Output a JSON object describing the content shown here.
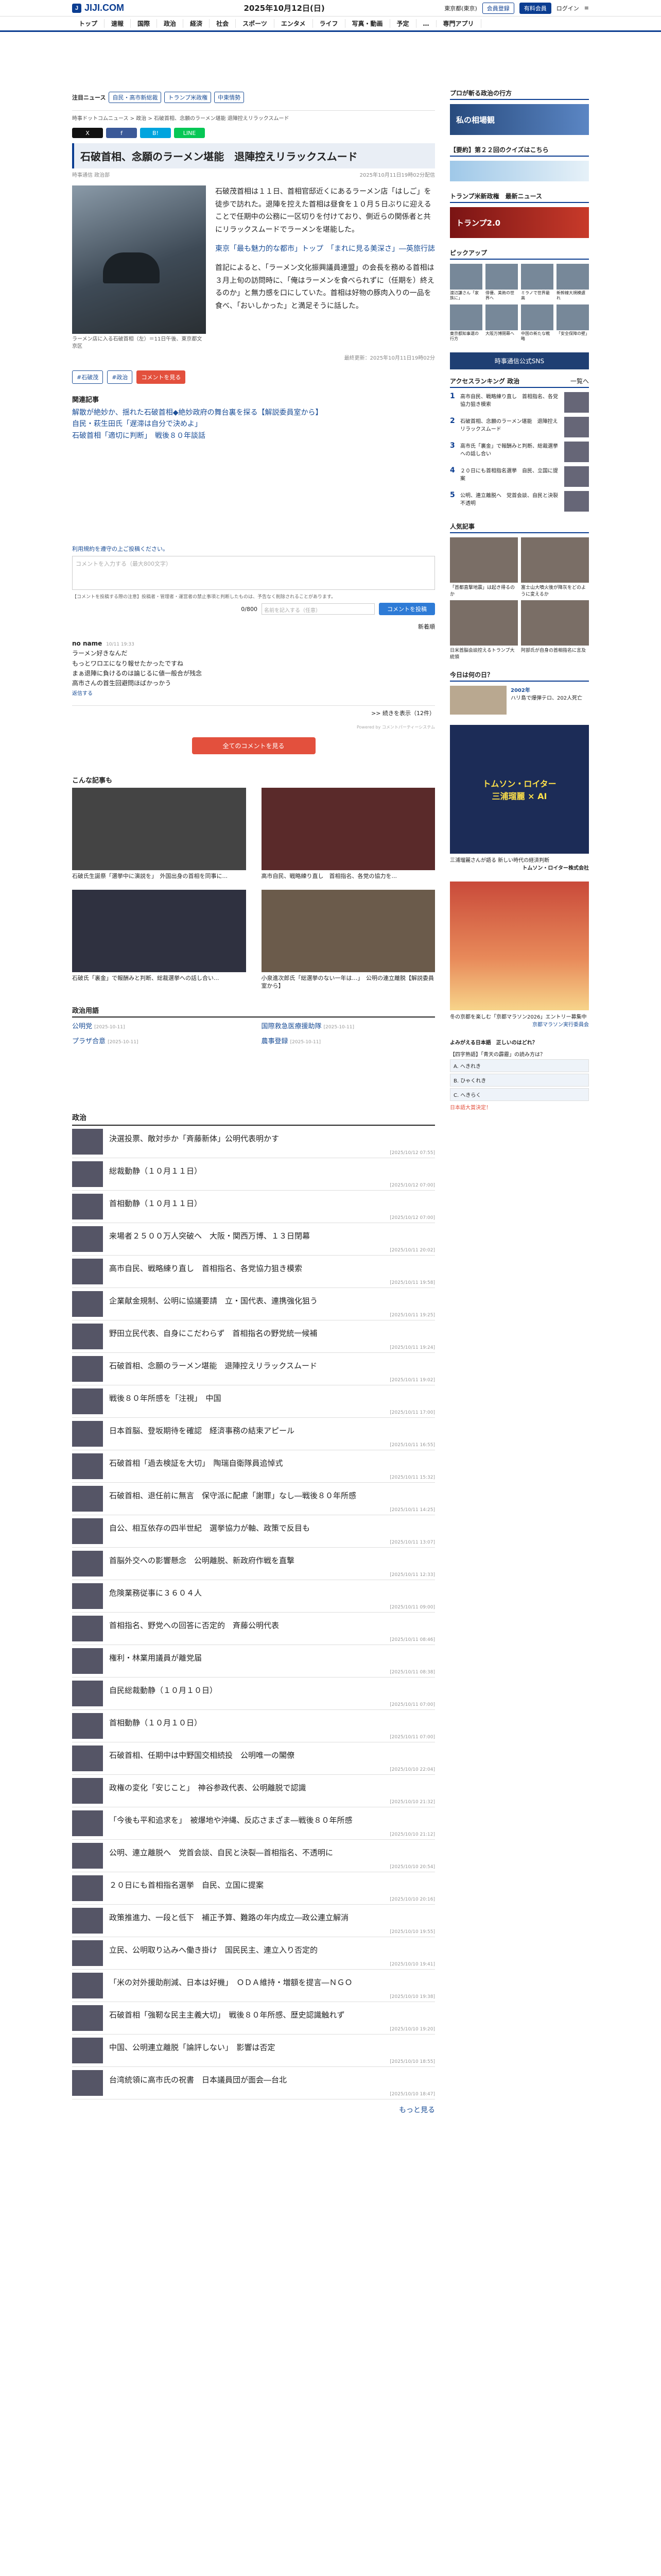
{
  "header": {
    "logo": "JIJI.COM",
    "date": "2025年10月12日(日)",
    "weather": "東京都(東京)",
    "links": [
      "会員登録",
      "有料会員",
      "ログイン",
      "≡"
    ]
  },
  "nav": [
    "トップ",
    "速報",
    "国際",
    "政治",
    "経済",
    "社会",
    "スポーツ",
    "エンタメ",
    "ライフ",
    "写真・動画",
    "予定",
    "…",
    "専門アプリ"
  ],
  "tags": {
    "label": "注目ニュース",
    "items": [
      "自民・高市新総裁",
      "トランプ米政権",
      "中東情勢"
    ]
  },
  "share": [
    "X",
    "f",
    "B!",
    "LINE"
  ],
  "breadcrumb": "時事ドットコムニュース > 政治 > 石破首相、念願のラーメン堪能 退陣控えリラックスムード",
  "article": {
    "title": "石破首相、念願のラーメン堪能　退陣控えリラックスムード",
    "author": "時事通信 政治部",
    "date": "2025年10月11日19時02分配信",
    "caption": "ラーメン店に入る石破首相（左）＝11日午後、東京都文京区",
    "p1": "石破茂首相は１１日、首相官邸近くにあるラーメン店「はしご」を徒歩で訪れた。退陣を控えた首相は昼食を１０月５日ぶりに迎えることで任期中の公務に一区切りを付けており、側近らの関係者と共にリラックスムードでラーメンを堪能した。",
    "link1": "東京「最も魅力的な都市」トップ　「まれに見る美深さ」―英旅行誌",
    "p2": "首記によると、「ラーメン文化振興議員連盟」の会長を務める首相は３月上旬の訪問時に、「俺はラーメンを食べられずに（任期を）終えるのか」と無力感を口にしていた。首相は好物の豚肉入りの一品を食べ、「おいしかった」と満足そうに話した。",
    "stamp": "最終更新：2025年10月11日19時02分",
    "buttons": [
      "#石破茂",
      "#政治",
      "コメントを見る"
    ]
  },
  "related": {
    "heading": "関連記事",
    "items": [
      "解散が絶妙か、揺れた石破首相◆絶妙政府の舞台裏を探る【解説委員室から】",
      "自民・萩生田氏「遅滞は自分で決めよ」",
      "石破首相「適切に判断」　戦後８０年談話"
    ]
  },
  "comments": {
    "note": "利用規約を遵守の上ご投稿ください。",
    "placeholder": "コメントを入力する（最大800文字）",
    "rule": "【コメントを投稿する際の注意】投稿者・管理者・運営者の禁止事項と判断したものは、予告なく削除されることがあります。",
    "counter": "0/800",
    "name_placeholder": "名前を記入する（任意）",
    "post": "コメントを投稿",
    "sort": "新着順",
    "item": {
      "name": "no name",
      "time": "10/11 19:33",
      "text": "ラーメン好きなんだ\nもっとワロエになり報せたかったですね\nまぁ退陣に負けるのは論じるに値一般合が残念\n高市さんの首生回避問ほばかっかう",
      "reply": "返信する"
    },
    "more": ">> 続きを表示（12件）",
    "powered": "Powered by コメントパーティーシステム",
    "all": "全てのコメントを見る"
  },
  "cards": {
    "heading": "こんな記事も",
    "items": [
      "石破氏生誕祭「選挙中に演説を」　外国出身の首相を同事に...",
      "高市自民、戦略練り直し　首相指名、各党の協力を...",
      "石破氏「裏金」で報酬みと判断、総裁選挙への話し合い...",
      "小泉進次郎氏「総選挙のない一年は…」　公明の連立離脱【解説委員室から】"
    ]
  },
  "seiji": {
    "heading": "政治用語",
    "items": [
      {
        "label": "公明党",
        "date": "[2025-10-11]"
      },
      {
        "label": "国際救急医療援助隊",
        "date": "[2025-10-11]"
      },
      {
        "label": "プラザ合意",
        "date": "[2025-10-11]"
      },
      {
        "label": "農事登録",
        "date": "[2025-10-11]"
      }
    ]
  },
  "politics": {
    "heading": "政治",
    "items": [
      {
        "t": "決選投票、敵対歩か「斉藤新体」公明代表明かす",
        "d": "[2025/10/12 07:55]"
      },
      {
        "t": "総裁動静（１０月１１日）",
        "d": "[2025/10/12 07:00]"
      },
      {
        "t": "首相動静（１０月１１日）",
        "d": "[2025/10/12 07:00]"
      },
      {
        "t": "来場者２５００万人突破へ　大阪・関西万博、１３日閉幕",
        "d": "[2025/10/11 20:02]"
      },
      {
        "t": "高市自民、戦略練り直し　首相指名、各党協力狙き模索",
        "d": "[2025/10/11 19:58]"
      },
      {
        "t": "企業献金規制、公明に協議要請　立・国代表、連携強化狙う",
        "d": "[2025/10/11 19:25]"
      },
      {
        "t": "野田立民代表、自身にこだわらず　首相指名の野党統一候補",
        "d": "[2025/10/11 19:24]"
      },
      {
        "t": "石破首相、念願のラーメン堪能　退陣控えリラックスムード",
        "d": "[2025/10/11 19:02]"
      },
      {
        "t": "戦後８０年所感を「注視」　中国",
        "d": "[2025/10/11 17:00]"
      },
      {
        "t": "日本首脳、登坂期待を確認　経済事務の結束アピール",
        "d": "[2025/10/11 16:55]"
      },
      {
        "t": "石破首相「過去検証を大切」　陶瑞自衛隊員追悼式",
        "d": "[2025/10/11 15:32]"
      },
      {
        "t": "石破首相、退任前に無言　保守派に配慮「謝罪」なし―戦後８０年所感",
        "d": "[2025/10/11 14:25]"
      },
      {
        "t": "自公、相互依存の四半世紀　選挙協力が軸、政策で反目も",
        "d": "[2025/10/11 13:07]"
      },
      {
        "t": "首脳外交への影響懸念　公明離脱、新政府作戦を直撃",
        "d": "[2025/10/11 12:33]"
      },
      {
        "t": "危険業務従事に３６０４人",
        "d": "[2025/10/11 09:00]"
      },
      {
        "t": "首相指名、野党への回答に否定的　斉藤公明代表",
        "d": "[2025/10/11 08:46]"
      },
      {
        "t": "権利・林業用議員が離党届",
        "d": "[2025/10/11 08:38]"
      },
      {
        "t": "自民総裁動静（１０月１０日）",
        "d": "[2025/10/11 07:00]"
      },
      {
        "t": "首相動静（１０月１０日）",
        "d": "[2025/10/11 07:00]"
      },
      {
        "t": "石破首相、任期中は中野国交相続投　公明唯一の閣僚",
        "d": "[2025/10/10 22:04]"
      },
      {
        "t": "政権の変化「安じこと」　神谷参政代表、公明離脱で認識",
        "d": "[2025/10/10 21:32]"
      },
      {
        "t": "「今後も平和追求を」　被爆地や沖縄、反応さまざま―戦後８０年所感",
        "d": "[2025/10/10 21:12]"
      },
      {
        "t": "公明、連立離脱へ　党首会談、自民と決裂―首相指名、不透明に",
        "d": "[2025/10/10 20:54]"
      },
      {
        "t": "２０日にも首相指名選挙　自民、立国に提案",
        "d": "[2025/10/10 20:16]"
      },
      {
        "t": "政策推進力、一段と低下　補正予算、難路の年内成立―政公連立解消",
        "d": "[2025/10/10 19:55]"
      },
      {
        "t": "立民、公明取り込みへ働き掛け　国民民主、連立入り否定的",
        "d": "[2025/10/10 19:41]"
      },
      {
        "t": "「米の対外援助削減、日本は好機」　ＯＤＡ維持・増額を提言―ＮＧＯ",
        "d": "[2025/10/10 19:38]"
      },
      {
        "t": "石破首相「強靭な民主主義大切」　戦後８０年所感、歴史認識触れず",
        "d": "[2025/10/10 19:20]"
      },
      {
        "t": "中国、公明連立離脱「論評しない」　影響は否定",
        "d": "[2025/10/10 18:55]"
      },
      {
        "t": "台湾統領に高市氏の祝書　日本議員団が面会―台北",
        "d": "[2025/10/10 18:47]"
      }
    ],
    "more": "もっと見る"
  },
  "sidebar": {
    "col_head": "プロが斬る政治の行方",
    "col_banner": "私の相場観",
    "quiz": "【要約】第２２回のクイズはこちら",
    "trump_head": "トランプ米新政権　最新ニュース",
    "trump_banner": "トランプ2.0",
    "pickup_head": "ピックアップ",
    "pickup": [
      "渡辺謙さん「家族に」",
      "俳優、美術の世界へ",
      "ミラノで世界最高",
      "新幹線大規模遅れ",
      "東京都知事選の行方",
      "大阪万博閉幕へ",
      "中国の新たな戦略",
      "「安全保障の壁」"
    ],
    "sns": "時事通信公式SNS",
    "rank_head": "アクセスランキング 政治",
    "rank_more": "一覧へ",
    "rank": [
      "高市自民、戦略練り直し　首相指名、各党協力狙き模索",
      "石破首相、念願のラーメン堪能　退陣控えリラックスムード",
      "高市氏「裏金」で報酬みと判断、総裁選挙への話し合い",
      "２０日にも首相指名選挙　自民、立国に提案",
      "公明、連立離脱へ　党首会談、自民と決裂　不透明"
    ],
    "people_head": "人気記事",
    "people": [
      "「首都直撃地震」は起き得るのか",
      "富士山大噴火後が降灰をどのように変えるか",
      "日米首脳会談控えるトランプ大統領",
      "阿部氏が自身の首相指名に言及"
    ],
    "today_head": "今日は何の日？",
    "today_year": "2002年",
    "today_text": "ハリ島で爆弾テロ、202人死亡",
    "ad_text": "トムソン・ロイター\n三浦瑠麗 × AI",
    "ad_caption": "三浦瑠麗さんが語る 新しい時代の経済判断",
    "ad_name": "トムソン・ロイター株式会社",
    "marathon_caption": "冬の京都を楽しむ「京都マラソン2026」エントリー募集中",
    "marathon_link": "京都マラソン実行委員会",
    "poll_head": "よみがえる日本語　正しいのはどれ？",
    "poll_q": "【四字熟語】「青天の霹靂」の読み方は？",
    "poll_opts": [
      "A. へきれき",
      "B. ひゃくれき",
      "C. へきらく"
    ],
    "poll_link": "日本語大賞決定！"
  }
}
